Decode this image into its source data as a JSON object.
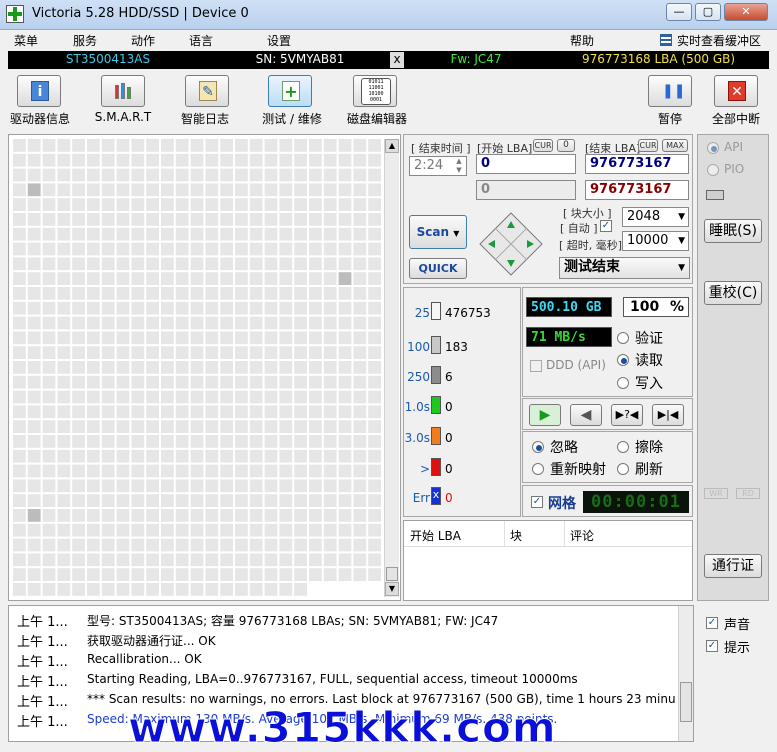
{
  "window": {
    "title": "Victoria 5.28 HDD/SSD | Device 0",
    "btn_min": "—",
    "btn_max": "▢",
    "btn_close": "✕"
  },
  "menu": {
    "items": [
      "菜单",
      "服务",
      "动作",
      "语言",
      "设置",
      "帮助"
    ],
    "cache_label": "实时查看缓冲区"
  },
  "info": {
    "model": "ST3500413AS",
    "sn": "SN: 5VMYAB81",
    "x": "x",
    "fw": "Fw: JC47",
    "lba": "976773168 LBA (500 GB)"
  },
  "toolbar": {
    "drive_info": "驱动器信息",
    "smart": "S.M.A.R.T",
    "smart_log": "智能日志",
    "test": "测试 / 维修",
    "disk_editor": "磁盘编辑器",
    "pause": "暂停",
    "stop_all": "全部中断",
    "editor_icon": "01011\n11001\n10100\n0001"
  },
  "scan_ctrl": {
    "end_time_label": "[ 结束时间 ]",
    "start_lba_label": "[开始 LBA]",
    "cur_label": "CUR",
    "zero_label": "0",
    "end_lba_label": "[结束 LBA]",
    "max_label": "MAX",
    "time_value": "2:24",
    "start_lba": "0",
    "end_lba": "976773167",
    "start_lba2": "0",
    "end_lba2": "976773167",
    "block_size_label": "[ 块大小 ]",
    "auto_label": "[ 自动 ]",
    "block_size": "2048",
    "timeout_label": "[ 超时, 毫秒]",
    "timeout": "10000",
    "scan_btn": "Scan",
    "quick_btn": "QUICK",
    "status": "测试结束"
  },
  "blocks": [
    {
      "label": "25",
      "color": "#f6f6f6",
      "count": "476753"
    },
    {
      "label": "100",
      "color": "#c8c8c8",
      "count": "183"
    },
    {
      "label": "250",
      "color": "#8c8c8c",
      "count": "6"
    },
    {
      "label": "1.0s",
      "color": "#1ec81e",
      "count": "0"
    },
    {
      "label": "3.0s",
      "color": "#f07c1e",
      "count": "0"
    },
    {
      "label": ">",
      "color": "#e01010",
      "count": "0"
    },
    {
      "label": "Err",
      "color": "#1430d8",
      "count": "0"
    }
  ],
  "stats": {
    "size": "500.10 GB",
    "percent": "100",
    "percent_unit": "%",
    "speed": "71 MB/s",
    "ddd_label": "DDD (API)"
  },
  "modes": {
    "verify": "验证",
    "read": "读取",
    "write": "写入"
  },
  "actions": {
    "ignore": "忽略",
    "erase": "擦除",
    "remap": "重新映射",
    "refresh": "刷新"
  },
  "grid_toggle": "网格",
  "timer": "00:00:01",
  "table": {
    "col_lba": "开始 LBA",
    "col_block": "块",
    "col_comment": "评论"
  },
  "side": {
    "api": "API",
    "pio": "PIO",
    "sleep": "睡眠(S)",
    "recal": "重校(C)",
    "wr": "WR",
    "rd": "RD",
    "passport": "通行证",
    "sound": "声音",
    "hint": "提示"
  },
  "log": [
    {
      "time": "上午 1...",
      "msg": "型号: ST3500413AS; 容量 976773168 LBAs; SN: 5VMYAB81; FW: JC47",
      "color": "#000000"
    },
    {
      "time": "上午 1...",
      "msg": "获取驱动器通行证... OK",
      "color": "#000000"
    },
    {
      "time": "上午 1...",
      "msg": "Recallibration... OK",
      "color": "#000000"
    },
    {
      "time": "上午 1...",
      "msg": "Starting Reading, LBA=0..976773167, FULL, sequential access, timeout 10000ms",
      "color": "#000000"
    },
    {
      "time": "上午 1...",
      "msg": "*** Scan results: no warnings, no errors. Last block at 976773167 (500 GB), time 1 hours 23 minu...",
      "color": "#000000"
    },
    {
      "time": "上午 1...",
      "msg": "Speed: Maximum 130 MB/s. Average 102 MB/s. Minimum 69 MB/s. 438 points.",
      "color": "#1a3cd0"
    }
  ],
  "watermark": "www.315kkk.com",
  "grid_marks": [
    [
      1,
      3
    ],
    [
      22,
      9
    ],
    [
      1,
      25
    ]
  ]
}
